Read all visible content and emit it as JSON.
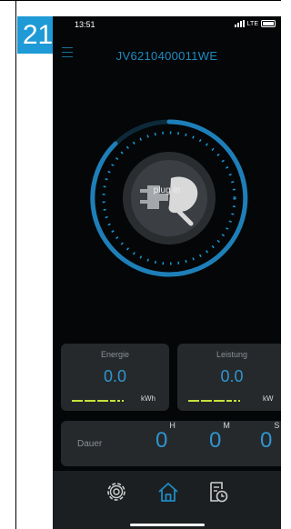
{
  "step_badge": "21",
  "status_bar": {
    "time": "13:51",
    "network": "LTE"
  },
  "header": {
    "title": "JV6210400011WE"
  },
  "charger": {
    "status_text": "plug in"
  },
  "energy": {
    "label": "Energie",
    "value": "0.0",
    "unit": "kWh"
  },
  "power": {
    "label": "Leistung",
    "value": "0.0",
    "unit": "kW"
  },
  "duration": {
    "label": "Dauer",
    "hours": "0",
    "hours_unit": "H",
    "minutes": "0",
    "minutes_unit": "M",
    "seconds": "0",
    "seconds_unit": "S"
  },
  "nav": {
    "items": [
      "settings-icon",
      "home-icon",
      "history-icon"
    ],
    "active": "home-icon"
  },
  "colors": {
    "accent": "#1e8bc3",
    "indicator": "#c7e23a",
    "background": "#040607",
    "card": "#25292c"
  }
}
